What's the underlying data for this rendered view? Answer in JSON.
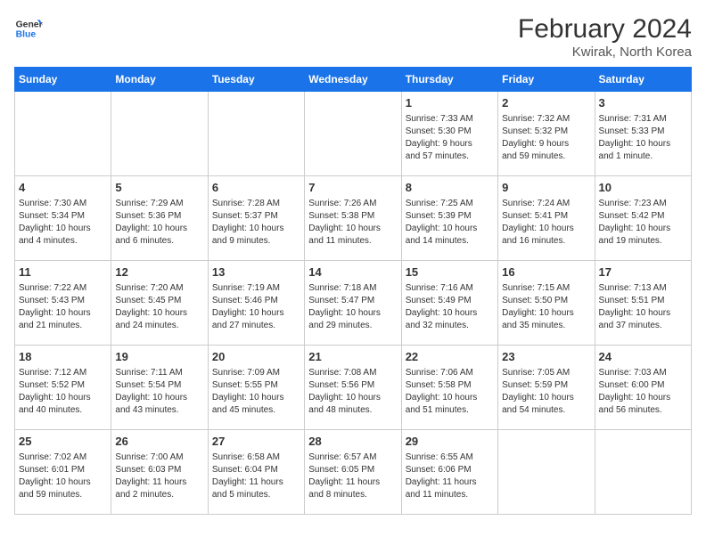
{
  "header": {
    "logo_line1": "General",
    "logo_line2": "Blue",
    "title": "February 2024",
    "subtitle": "Kwirak, North Korea"
  },
  "weekdays": [
    "Sunday",
    "Monday",
    "Tuesday",
    "Wednesday",
    "Thursday",
    "Friday",
    "Saturday"
  ],
  "weeks": [
    [
      {
        "day": "",
        "info": ""
      },
      {
        "day": "",
        "info": ""
      },
      {
        "day": "",
        "info": ""
      },
      {
        "day": "",
        "info": ""
      },
      {
        "day": "1",
        "info": "Sunrise: 7:33 AM\nSunset: 5:30 PM\nDaylight: 9 hours\nand 57 minutes."
      },
      {
        "day": "2",
        "info": "Sunrise: 7:32 AM\nSunset: 5:32 PM\nDaylight: 9 hours\nand 59 minutes."
      },
      {
        "day": "3",
        "info": "Sunrise: 7:31 AM\nSunset: 5:33 PM\nDaylight: 10 hours\nand 1 minute."
      }
    ],
    [
      {
        "day": "4",
        "info": "Sunrise: 7:30 AM\nSunset: 5:34 PM\nDaylight: 10 hours\nand 4 minutes."
      },
      {
        "day": "5",
        "info": "Sunrise: 7:29 AM\nSunset: 5:36 PM\nDaylight: 10 hours\nand 6 minutes."
      },
      {
        "day": "6",
        "info": "Sunrise: 7:28 AM\nSunset: 5:37 PM\nDaylight: 10 hours\nand 9 minutes."
      },
      {
        "day": "7",
        "info": "Sunrise: 7:26 AM\nSunset: 5:38 PM\nDaylight: 10 hours\nand 11 minutes."
      },
      {
        "day": "8",
        "info": "Sunrise: 7:25 AM\nSunset: 5:39 PM\nDaylight: 10 hours\nand 14 minutes."
      },
      {
        "day": "9",
        "info": "Sunrise: 7:24 AM\nSunset: 5:41 PM\nDaylight: 10 hours\nand 16 minutes."
      },
      {
        "day": "10",
        "info": "Sunrise: 7:23 AM\nSunset: 5:42 PM\nDaylight: 10 hours\nand 19 minutes."
      }
    ],
    [
      {
        "day": "11",
        "info": "Sunrise: 7:22 AM\nSunset: 5:43 PM\nDaylight: 10 hours\nand 21 minutes."
      },
      {
        "day": "12",
        "info": "Sunrise: 7:20 AM\nSunset: 5:45 PM\nDaylight: 10 hours\nand 24 minutes."
      },
      {
        "day": "13",
        "info": "Sunrise: 7:19 AM\nSunset: 5:46 PM\nDaylight: 10 hours\nand 27 minutes."
      },
      {
        "day": "14",
        "info": "Sunrise: 7:18 AM\nSunset: 5:47 PM\nDaylight: 10 hours\nand 29 minutes."
      },
      {
        "day": "15",
        "info": "Sunrise: 7:16 AM\nSunset: 5:49 PM\nDaylight: 10 hours\nand 32 minutes."
      },
      {
        "day": "16",
        "info": "Sunrise: 7:15 AM\nSunset: 5:50 PM\nDaylight: 10 hours\nand 35 minutes."
      },
      {
        "day": "17",
        "info": "Sunrise: 7:13 AM\nSunset: 5:51 PM\nDaylight: 10 hours\nand 37 minutes."
      }
    ],
    [
      {
        "day": "18",
        "info": "Sunrise: 7:12 AM\nSunset: 5:52 PM\nDaylight: 10 hours\nand 40 minutes."
      },
      {
        "day": "19",
        "info": "Sunrise: 7:11 AM\nSunset: 5:54 PM\nDaylight: 10 hours\nand 43 minutes."
      },
      {
        "day": "20",
        "info": "Sunrise: 7:09 AM\nSunset: 5:55 PM\nDaylight: 10 hours\nand 45 minutes."
      },
      {
        "day": "21",
        "info": "Sunrise: 7:08 AM\nSunset: 5:56 PM\nDaylight: 10 hours\nand 48 minutes."
      },
      {
        "day": "22",
        "info": "Sunrise: 7:06 AM\nSunset: 5:58 PM\nDaylight: 10 hours\nand 51 minutes."
      },
      {
        "day": "23",
        "info": "Sunrise: 7:05 AM\nSunset: 5:59 PM\nDaylight: 10 hours\nand 54 minutes."
      },
      {
        "day": "24",
        "info": "Sunrise: 7:03 AM\nSunset: 6:00 PM\nDaylight: 10 hours\nand 56 minutes."
      }
    ],
    [
      {
        "day": "25",
        "info": "Sunrise: 7:02 AM\nSunset: 6:01 PM\nDaylight: 10 hours\nand 59 minutes."
      },
      {
        "day": "26",
        "info": "Sunrise: 7:00 AM\nSunset: 6:03 PM\nDaylight: 11 hours\nand 2 minutes."
      },
      {
        "day": "27",
        "info": "Sunrise: 6:58 AM\nSunset: 6:04 PM\nDaylight: 11 hours\nand 5 minutes."
      },
      {
        "day": "28",
        "info": "Sunrise: 6:57 AM\nSunset: 6:05 PM\nDaylight: 11 hours\nand 8 minutes."
      },
      {
        "day": "29",
        "info": "Sunrise: 6:55 AM\nSunset: 6:06 PM\nDaylight: 11 hours\nand 11 minutes."
      },
      {
        "day": "",
        "info": ""
      },
      {
        "day": "",
        "info": ""
      }
    ]
  ]
}
